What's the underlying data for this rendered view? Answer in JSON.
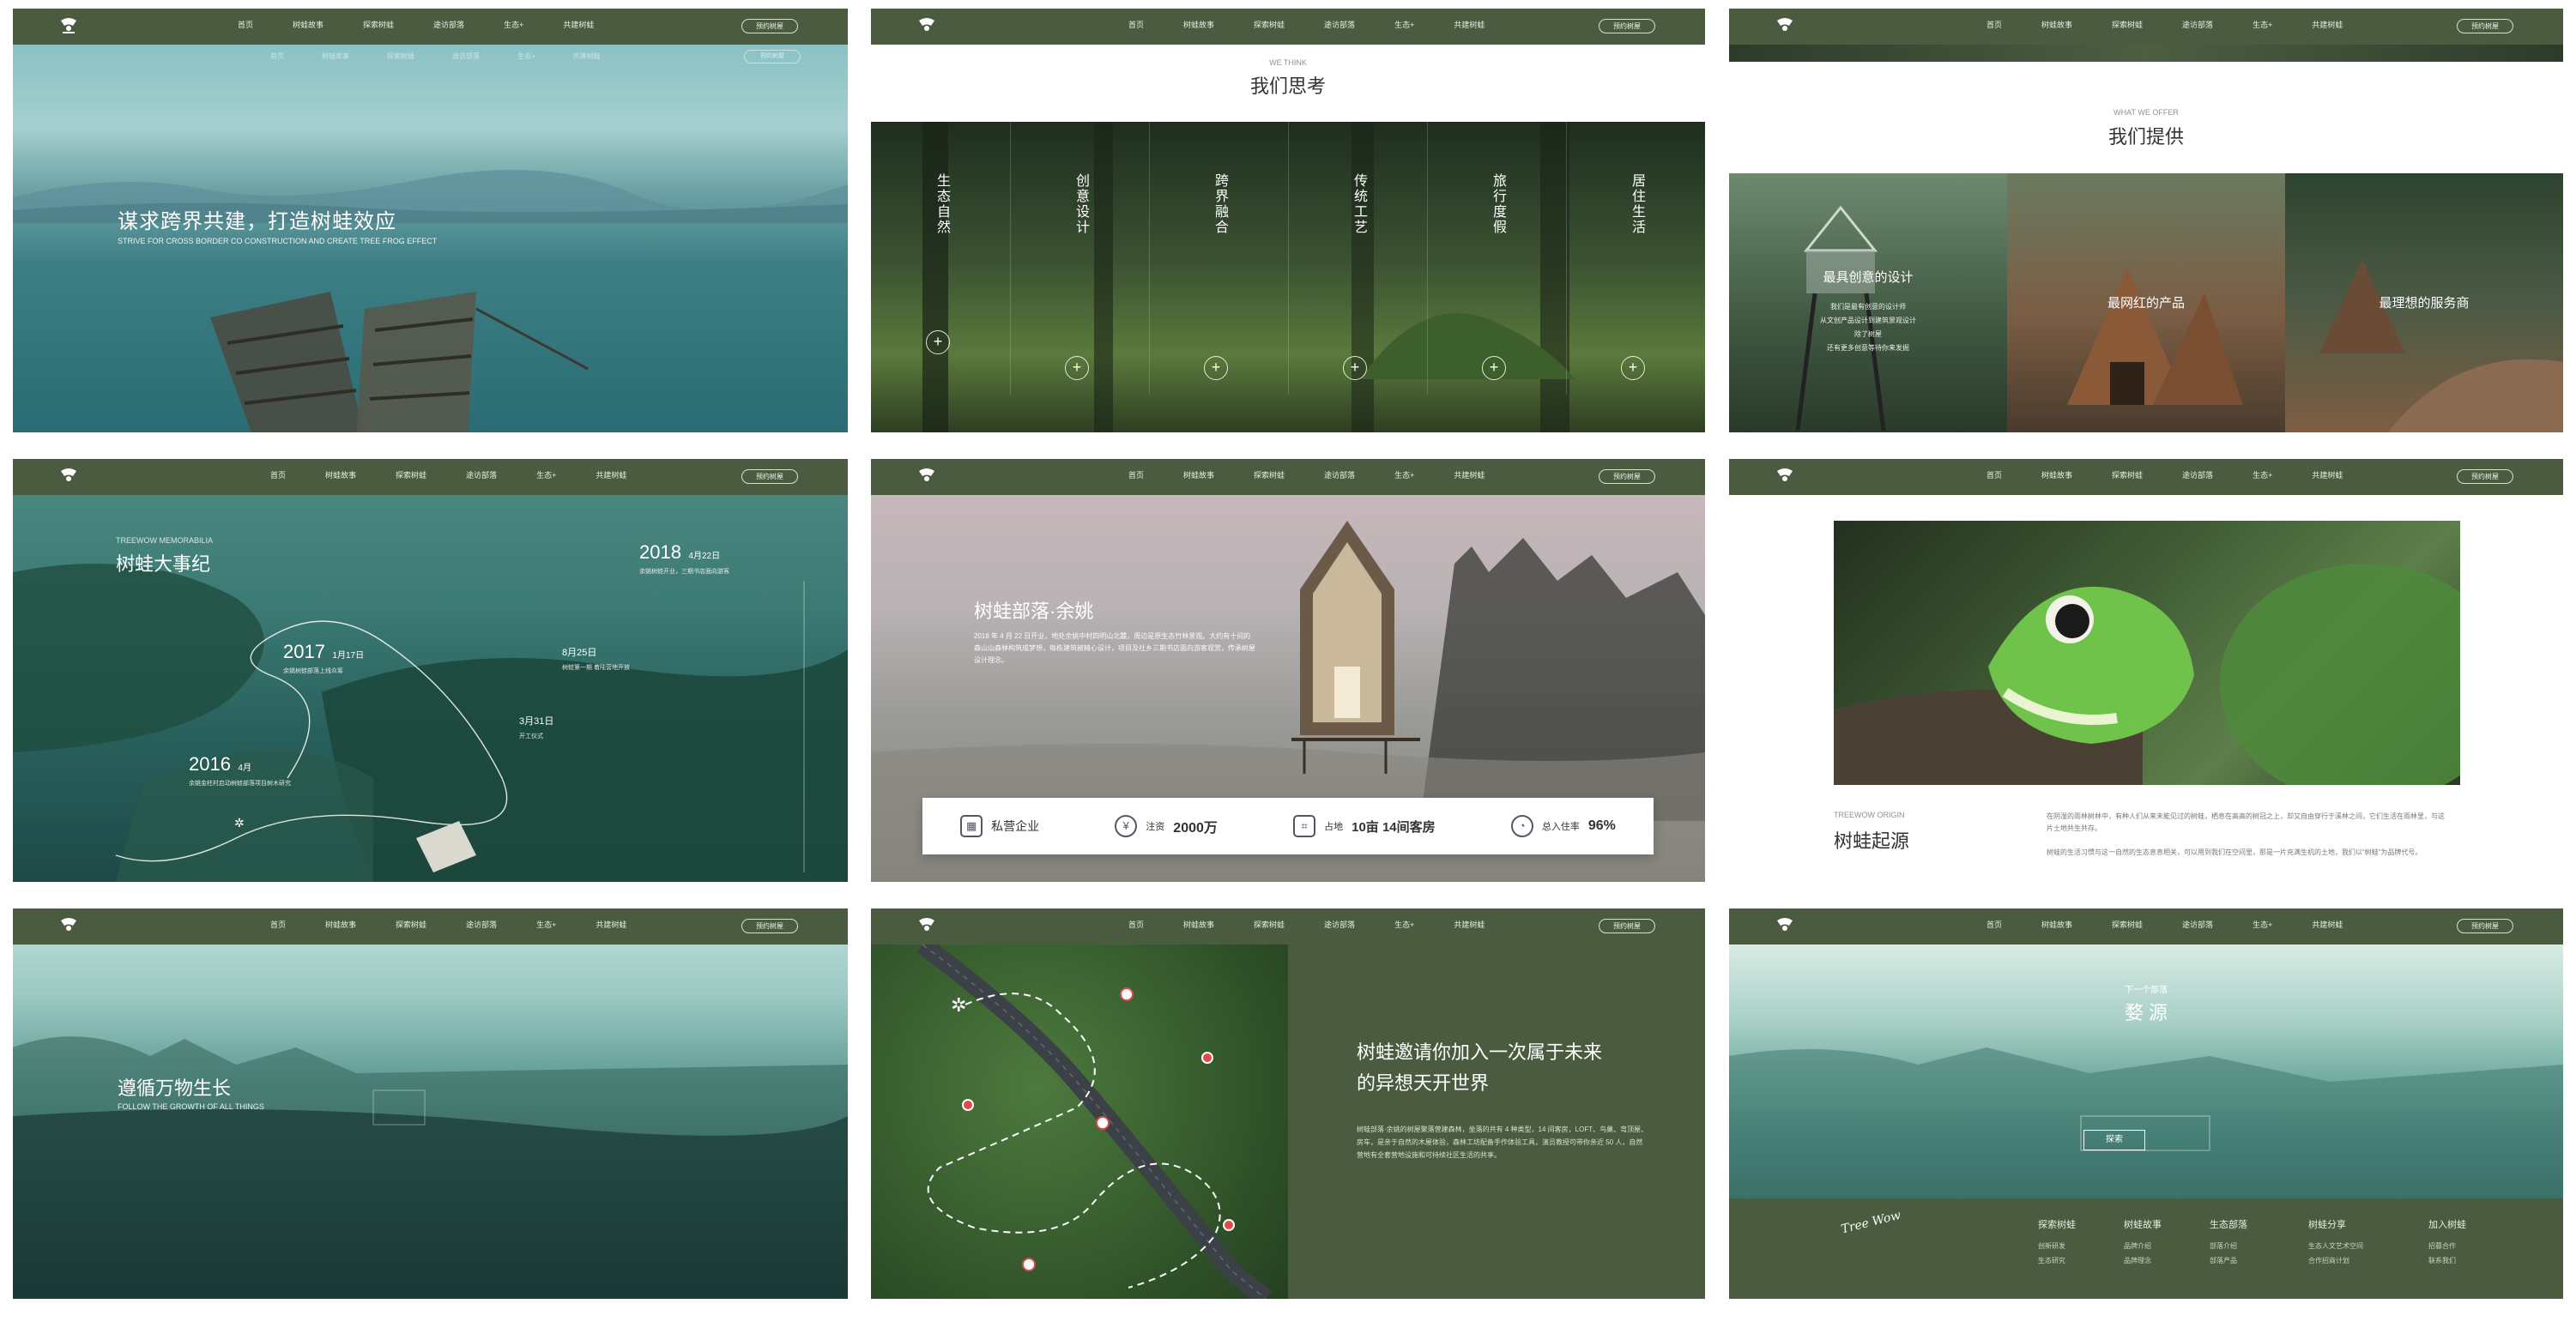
{
  "nav": {
    "items": [
      "首页",
      "树蛙故事",
      "探索树蛙",
      "途访部落",
      "生态+",
      "共建树蛙"
    ],
    "cta": "预约树屋"
  },
  "hero1": {
    "title": "谋求跨界共建，打造树蛙效应",
    "subtitle": "STRIVE FOR CROSS BORDER CO CONSTRUCTION AND CREATE TREE FROG EFFECT"
  },
  "think": {
    "en": "WE THINK",
    "title": "我们思考",
    "items": [
      "生态自然",
      "创意设计",
      "跨界融合",
      "传统工艺",
      "旅行度假",
      "居住生活"
    ]
  },
  "offer": {
    "en": "WHAT WE OFFER",
    "title": "我们提供",
    "cards": [
      {
        "title": "最具创意的设计",
        "lines": [
          "我们是最有创意的设计师",
          "从文创产品设计到建筑景观设计",
          "除了树屋",
          "还有更多创意等待你来发掘"
        ]
      },
      {
        "title": "最网红的产品",
        "lines": []
      },
      {
        "title": "最理想的服务商",
        "lines": []
      }
    ]
  },
  "memorabilia": {
    "en": "TREEWOW MEMORABILIA",
    "title": "树蛙大事纪",
    "events": [
      {
        "year": "2018",
        "date": "4月22日",
        "desc": "余姚树蛙开业，三期书店面向游客"
      },
      {
        "year": "2017",
        "date": "1月17日",
        "desc": "余姚树蛙部落上线众筹"
      },
      {
        "year": "",
        "date": "8月25日",
        "desc": "树蛙第一期 着陆营地开放"
      },
      {
        "year": "",
        "date": "3月31日",
        "desc": "开工仪式"
      },
      {
        "year": "2016",
        "date": "4月",
        "desc": "余姚金柱村启动树蛙部落项目树木研究"
      }
    ]
  },
  "tribe": {
    "title": "树蛙部落·余姚",
    "desc": "2018 年 4 月 22 日开业，地处余姚中村四明山北麓，周边是原生态竹林景观。大约有十间的森山山森林构筑成梦想，每栋建筑被精心设计，项目及社乡三期书店面向游客观赏，传承树屋设计理念。",
    "stats": [
      {
        "icon": "building-icon",
        "label": "私营企业",
        "value": ""
      },
      {
        "icon": "yen-icon",
        "label": "注资",
        "value": "2000万"
      },
      {
        "icon": "area-icon",
        "label": "占地",
        "value": "10亩  14间客房"
      },
      {
        "icon": "pie-icon",
        "label": "总入住率",
        "value": "96%"
      }
    ]
  },
  "origin": {
    "en": "TREEWOW ORIGIN",
    "title": "树蛙起源",
    "p1": "在阴湿的雨林树林中，有种人们从来未能见过的树蛙，栖息在高高的树冠之上，却又自由穿行于溪林之间，它们生活在雨林里，与这片土地共生共存。",
    "p2": "树蛙的生活习惯与这一自然的生态息息相关，可以用到我们在空间里，那是一片充满生机的土地，我们以“树蛙”为品牌代号。"
  },
  "hero2": {
    "title": "遵循万物生长",
    "subtitle": "FOLLOW THE GROWTH OF ALL THINGS"
  },
  "invite": {
    "title1": "树蛙邀请你加入一次属于未来",
    "title2": "的异想天开世界",
    "desc": "树蛙部落·余姚的树屋聚落营建森林，坐落的共有 4 种类型，14 间客房，LOFT、鸟巢、弯顶屋、房车，是亲于自然的木屋体验，森林工坊配备手作体验工具，演员教授可带你亲近 50 人，自然营地有全套营地设施和可持续社区生活的共享。"
  },
  "next": {
    "label": "下一个部落",
    "title": "婺 源",
    "button": "探索"
  },
  "footer": {
    "brand": "Tree Wow",
    "cols": [
      {
        "title": "探索树蛙",
        "items": [
          "创新研发",
          "生态研究"
        ]
      },
      {
        "title": "树蛙故事",
        "items": [
          "品牌介绍",
          "品牌理念"
        ]
      },
      {
        "title": "生态部落",
        "items": [
          "部落介绍",
          "部落产品"
        ]
      },
      {
        "title": "树蛙分享",
        "items": [
          "生态人文艺术空间",
          "合作招商计划"
        ]
      },
      {
        "title": "加入树蛙",
        "items": [
          "招募合作",
          "联系我们"
        ]
      }
    ]
  }
}
